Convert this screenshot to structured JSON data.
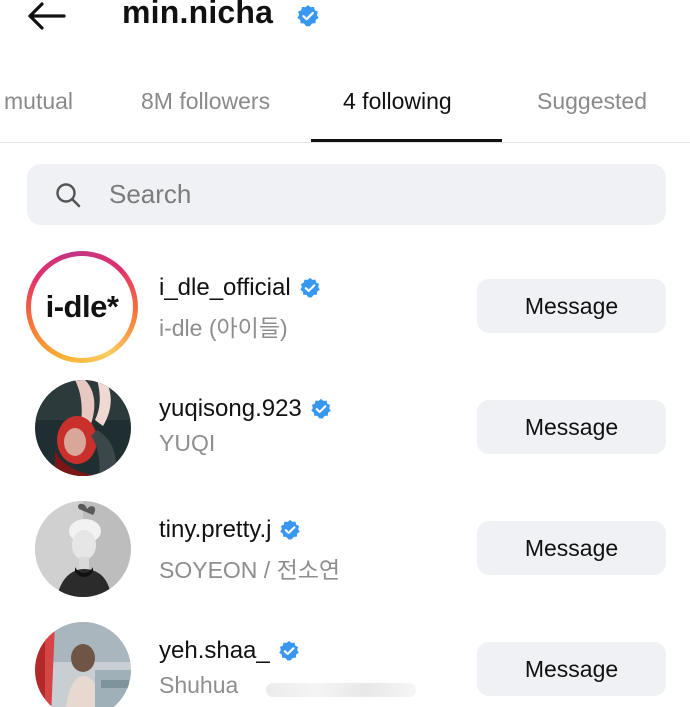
{
  "header": {
    "back_icon": "arrow-left-icon",
    "username": "min.nicha",
    "verified_icon": "verified-badge-icon"
  },
  "tabs": [
    {
      "label": "mutual",
      "active": false
    },
    {
      "label": "8M followers",
      "active": false
    },
    {
      "label": "4 following",
      "active": true
    },
    {
      "label": "Suggested",
      "active": false
    }
  ],
  "search": {
    "placeholder": "Search",
    "icon": "search-icon"
  },
  "colors": {
    "verified_blue": "#3897f0",
    "button_bg": "#eff1f4",
    "muted_text": "#8e8e8e"
  },
  "following": [
    {
      "handle": "i_dle_official",
      "name": "i-dle (아이들)",
      "verified": true,
      "button": "Message",
      "avatar_logo": "i-dle*",
      "story_ring": true
    },
    {
      "handle": "yuqisong.923",
      "name": "YUQI",
      "verified": true,
      "button": "Message",
      "story_ring": false
    },
    {
      "handle": "tiny.pretty.j",
      "name": "SOYEON / 전소연",
      "verified": true,
      "button": "Message",
      "story_ring": false
    },
    {
      "handle": "yeh.shaa_",
      "name": "Shuhua",
      "verified": true,
      "button": "Message",
      "story_ring": false
    }
  ]
}
